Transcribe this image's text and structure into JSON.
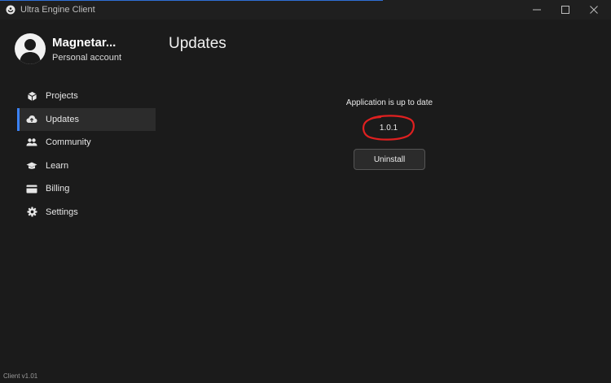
{
  "window": {
    "title": "Ultra Engine Client",
    "accent_color": "#2f6fd6"
  },
  "profile": {
    "username": "Magnetar...",
    "account_type": "Personal account"
  },
  "sidebar": {
    "active_color": "#3b82f6",
    "items": [
      {
        "label": "Projects",
        "icon": "cube-icon"
      },
      {
        "label": "Updates",
        "icon": "cloud-upload-icon"
      },
      {
        "label": "Community",
        "icon": "people-icon"
      },
      {
        "label": "Learn",
        "icon": "graduation-cap-icon"
      },
      {
        "label": "Billing",
        "icon": "credit-card-icon"
      },
      {
        "label": "Settings",
        "icon": "gear-icon"
      }
    ]
  },
  "main": {
    "title": "Updates",
    "status": "Application is up to date",
    "version": "1.0.1",
    "annotation_color": "#e02020",
    "uninstall_label": "Uninstall"
  },
  "footer": {
    "version_text": "Client v1.01"
  }
}
